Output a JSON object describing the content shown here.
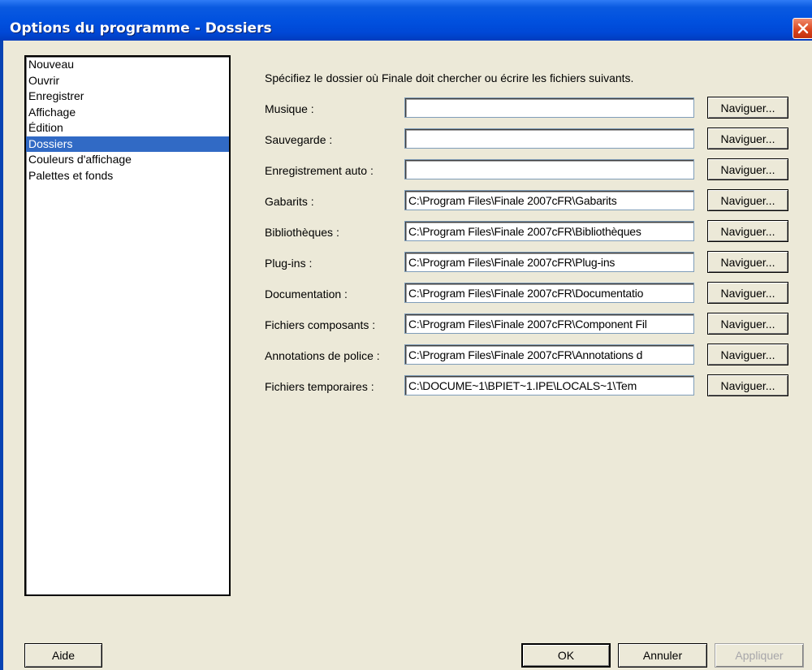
{
  "window": {
    "title": "Options du programme - Dossiers"
  },
  "sidebar": {
    "items": [
      {
        "label": "Nouveau",
        "selected": false
      },
      {
        "label": "Ouvrir",
        "selected": false
      },
      {
        "label": "Enregistrer",
        "selected": false
      },
      {
        "label": "Affichage",
        "selected": false
      },
      {
        "label": "Édition",
        "selected": false
      },
      {
        "label": "Dossiers",
        "selected": true
      },
      {
        "label": "Couleurs d'affichage",
        "selected": false
      },
      {
        "label": "Palettes et fonds",
        "selected": false
      }
    ]
  },
  "main": {
    "intro": "Spécifiez le dossier où Finale doit chercher ou écrire les fichiers suivants.",
    "browse_label": "Naviguer...",
    "rows": [
      {
        "label": "Musique :",
        "value": ""
      },
      {
        "label": "Sauvegarde :",
        "value": ""
      },
      {
        "label": "Enregistrement auto :",
        "value": ""
      },
      {
        "label": "Gabarits :",
        "value": "C:\\Program Files\\Finale 2007cFR\\Gabarits"
      },
      {
        "label": "Bibliothèques :",
        "value": "C:\\Program Files\\Finale 2007cFR\\Bibliothèques"
      },
      {
        "label": "Plug-ins :",
        "value": "C:\\Program Files\\Finale 2007cFR\\Plug-ins"
      },
      {
        "label": "Documentation :",
        "value": "C:\\Program Files\\Finale 2007cFR\\Documentatio"
      },
      {
        "label": "Fichiers composants :",
        "value": "C:\\Program Files\\Finale 2007cFR\\Component Fil"
      },
      {
        "label": "Annotations de police :",
        "value": "C:\\Program Files\\Finale 2007cFR\\Annotations d"
      },
      {
        "label": "Fichiers temporaires :",
        "value": "C:\\DOCUME~1\\BPIET~1.IPE\\LOCALS~1\\Tem"
      }
    ]
  },
  "footer": {
    "help_label": "Aide",
    "ok_label": "OK",
    "cancel_label": "Annuler",
    "apply_label": "Appliquer",
    "apply_enabled": false
  },
  "colors": {
    "titlebar": "#0151df",
    "selection": "#316ac5",
    "dialog_bg": "#ece9d8",
    "close_button": "#d9431c"
  },
  "icons": {
    "close": "close-icon"
  }
}
